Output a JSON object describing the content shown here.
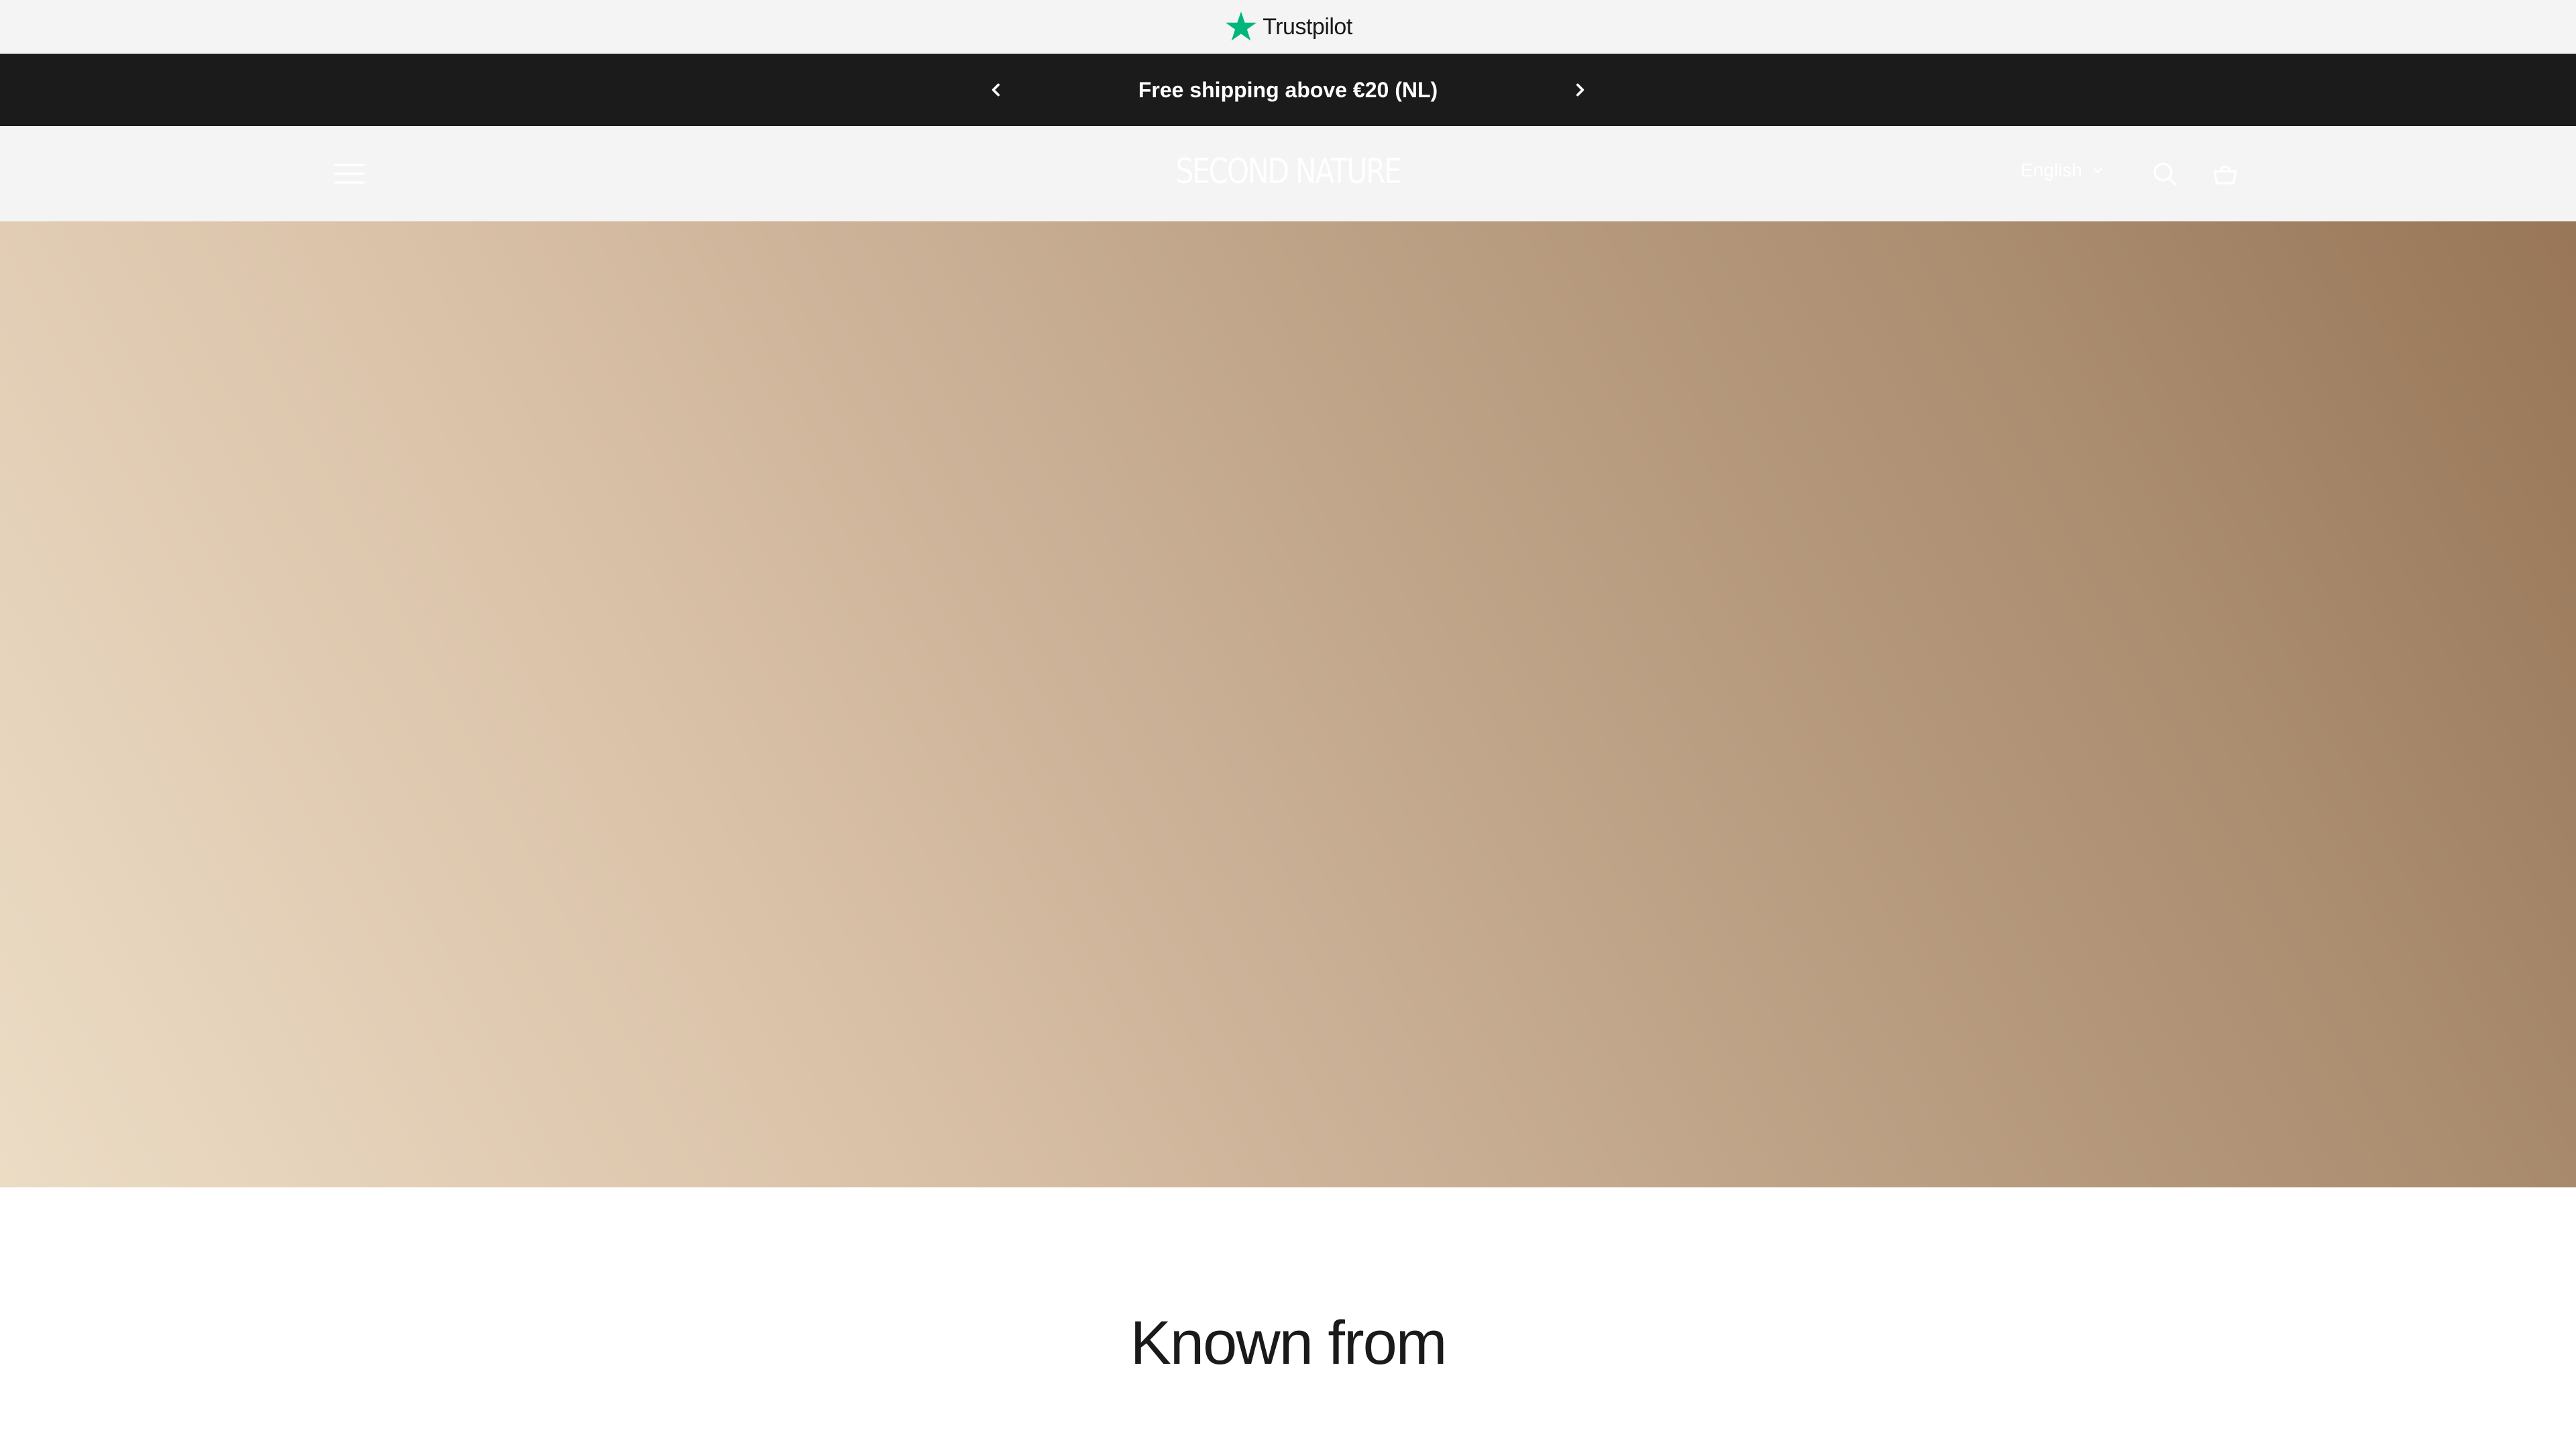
{
  "trustpilot": {
    "label": "Trustpilot",
    "star_color": "#00b67a",
    "icon": "star-icon"
  },
  "announcement": {
    "text": "Free shipping above €20 (NL)",
    "prev_icon": "chevron-left-icon",
    "next_icon": "chevron-right-icon",
    "background": "#1b1b1b"
  },
  "header": {
    "logo": "SECOND NATURE",
    "language": "English",
    "menu_icon": "hamburger-menu-icon",
    "search_icon": "search-icon",
    "cart_icon": "cart-icon"
  },
  "known_from": {
    "title": "Known from"
  },
  "colors": {
    "header_bg": "#f4f4f4",
    "hero_gradient_start": "#ecdcc5",
    "hero_gradient_end": "#987657",
    "text_dark": "#1a1a1a"
  }
}
